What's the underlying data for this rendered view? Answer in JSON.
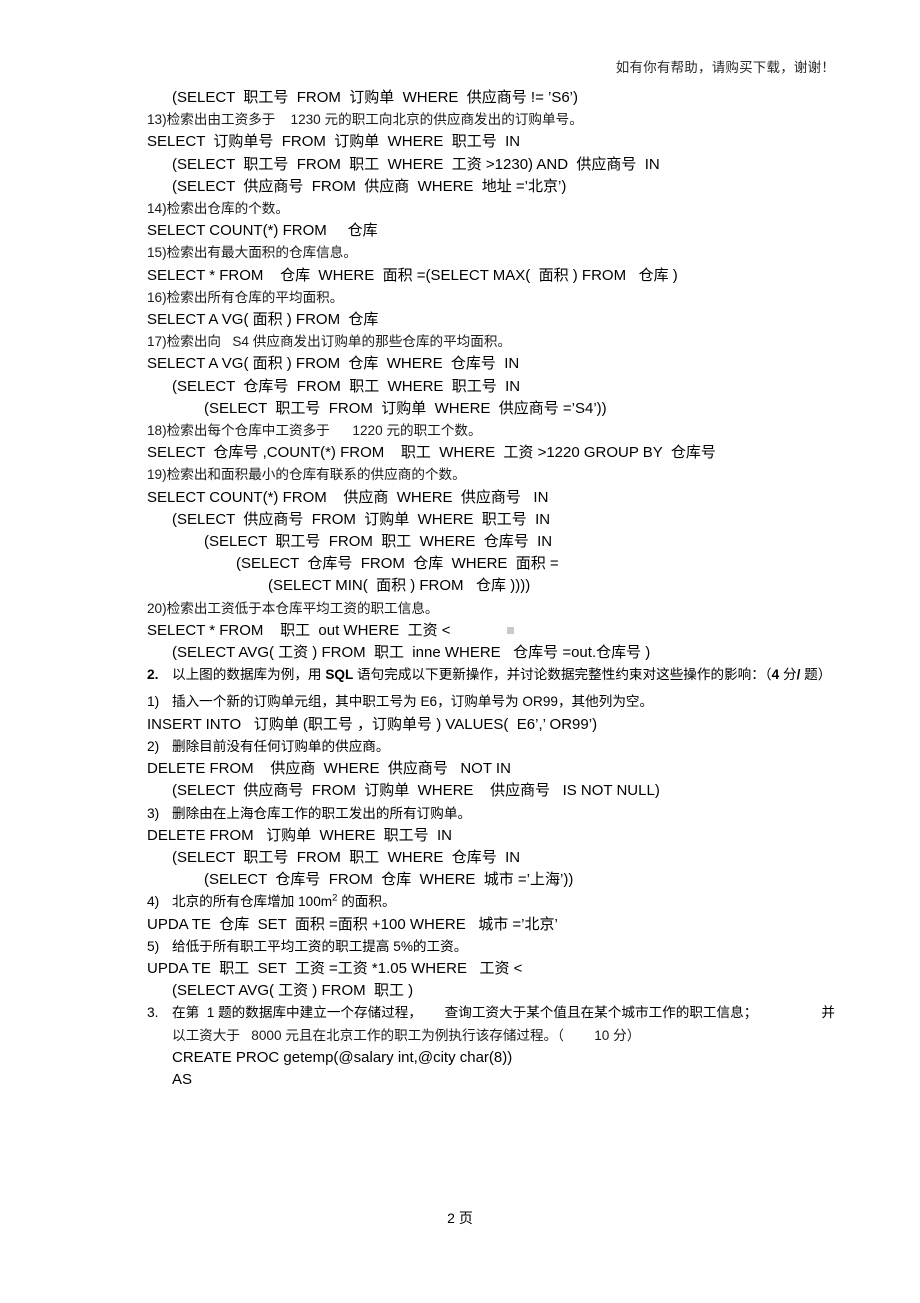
{
  "header": {
    "notice": "如有你有帮助，请购买下载，谢谢！"
  },
  "footer": {
    "page_label": "2 页"
  },
  "body": {
    "q12_tail": "(SELECT  职工号  FROM  订购单  WHERE  供应商号 != ’S6’)",
    "q13": {
      "desc": "13)检索出由工资多于    1230 元的职工向北京的供应商发出的订购单号。",
      "l1": "SELECT  订购单号  FROM  订购单  WHERE  职工号  IN",
      "l2": "(SELECT  职工号  FROM  职工  WHERE  工资 >1230) AND  供应商号  IN",
      "l3": "(SELECT  供应商号  FROM  供应商  WHERE  地址 =’北京’)"
    },
    "q14": {
      "desc": "14)检索出仓库的个数。",
      "l1": "SELECT COUNT(*) FROM     仓库"
    },
    "q15": {
      "desc": "15)检索出有最大面积的仓库信息。",
      "l1": "SELECT * FROM    仓库  WHERE  面积 =(SELECT MAX(  面积 ) FROM   仓库 )"
    },
    "q16": {
      "desc": "16)检索出所有仓库的平均面积。",
      "l1": "SELECT A VG( 面积 ) FROM  仓库"
    },
    "q17": {
      "desc": "17)检索出向   S4 供应商发出订购单的那些仓库的平均面积。",
      "l1": "SELECT A VG( 面积 ) FROM  仓库  WHERE  仓库号  IN",
      "l2": "(SELECT  仓库号  FROM  职工  WHERE  职工号  IN",
      "l3": "(SELECT  职工号  FROM  订购单  WHERE  供应商号 =’S4’))"
    },
    "q18": {
      "desc": "18)检索出每个仓库中工资多于      1220 元的职工个数。",
      "l1": "SELECT  仓库号 ,COUNT(*) FROM    职工  WHERE  工资 >1220 GROUP BY  仓库号"
    },
    "q19": {
      "desc": "19)检索出和面积最小的仓库有联系的供应商的个数。",
      "l1": "SELECT COUNT(*) FROM    供应商  WHERE  供应商号   IN",
      "l2": "(SELECT  供应商号  FROM  订购单  WHERE  职工号  IN",
      "l3": "(SELECT  职工号  FROM  职工  WHERE  仓库号  IN",
      "l4": "(SELECT  仓库号  FROM  仓库  WHERE  面积 =",
      "l5": "(SELECT MIN(  面积 ) FROM   仓库 ))))"
    },
    "q20": {
      "desc": "20)检索出工资低于本仓库平均工资的职工信息。",
      "l1_pre": "SELECT * FROM    职工  out WHERE  工资 <",
      "l2": "(SELECT AVG( 工资 ) FROM  职工  inne WHERE   仓库号 =out.仓库号 )"
    },
    "item2": {
      "marker": "2.",
      "text_a": "以上图的数据库为例，用     ",
      "text_sql": "SQL",
      "text_b": " 语句完成以下更新操作，并讨论数据完整性约束对这些操作的影响：（",
      "text_num": "4",
      "text_c": " 分",
      "text_slash": "/",
      "text_d": " 题）",
      "sub1": {
        "marker": "1)",
        "desc": "插入一个新的订购单元组，其中职工号为        E6，订购单号为    OR99，其他列为空。",
        "l1": "INSERT INTO   订购单 (职工号 ，订购单号 ) VALUES(  E6’,’ OR99’)"
      },
      "sub2": {
        "marker": "2)",
        "desc": "删除目前没有任何订购单的供应商。",
        "l1": "DELETE FROM    供应商  WHERE  供应商号   NOT IN",
        "l2": "(SELECT  供应商号  FROM  订购单  WHERE    供应商号   IS NOT NULL)"
      },
      "sub3": {
        "marker": "3)",
        "desc": "删除由在上海仓库工作的职工发出的所有订购单。",
        "l1": "DELETE FROM   订购单  WHERE  职工号  IN",
        "l2": "(SELECT  职工号  FROM  职工  WHERE  仓库号  IN",
        "l3": "(SELECT  仓库号  FROM  仓库  WHERE  城市 =’上海’))"
      },
      "sub4": {
        "marker": "4)",
        "desc_a": "北京的所有仓库增加    100m",
        "desc_sup": "2",
        "desc_b": " 的面积。",
        "l1": "UPDA TE  仓库  SET  面积 =面积 +100 WHERE   城市 =’北京’"
      },
      "sub5": {
        "marker": "5)",
        "desc": "给低于所有职工平均工资的职工提高       5%的工资。",
        "l1": "UPDA TE  职工  SET  工资 =工资 *1.05 WHERE   工资 <",
        "l2": "(SELECT AVG( 工资 ) FROM  职工 )"
      }
    },
    "item3": {
      "marker": "3.",
      "line1_a": "在第  1 题的数据库中建立一个存储过程，      查询工资大于某个值且在某个城市工作的职工信息；",
      "line1_b": "并",
      "line2": "以工资大于   8000 元且在北京工作的职工为例执行该存储过程。（        10 分）",
      "l1": "CREATE PROC getemp(@salary int,@city char(8))",
      "l2": "AS"
    }
  }
}
